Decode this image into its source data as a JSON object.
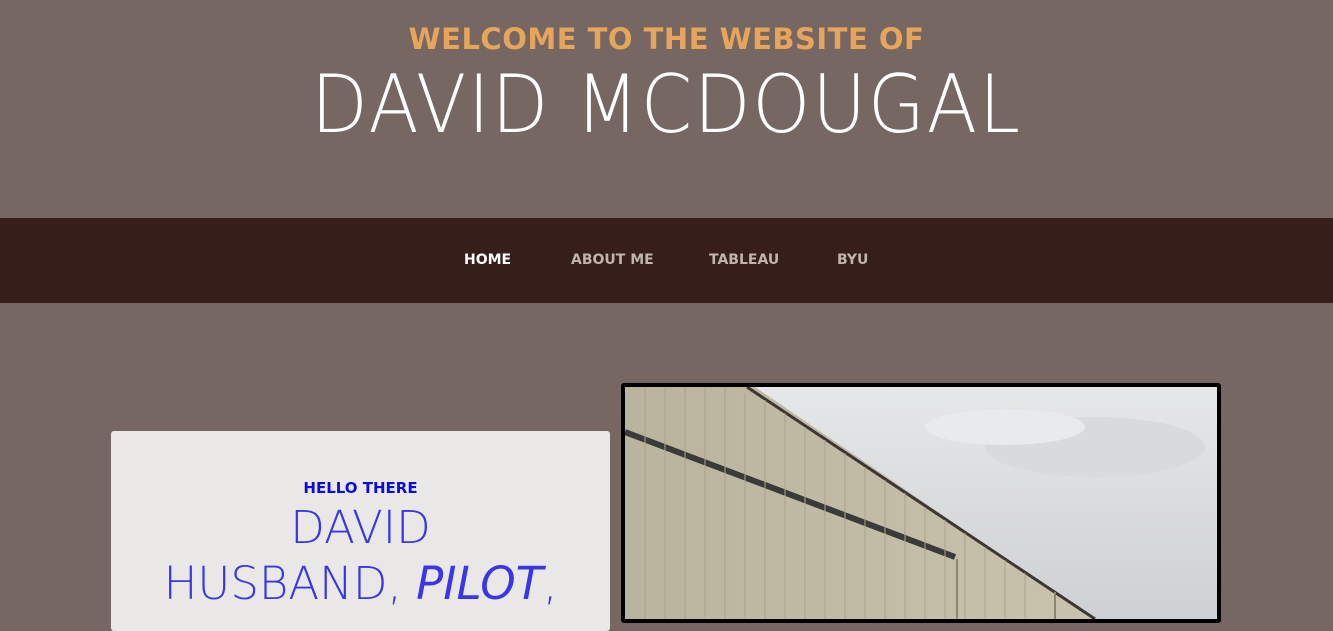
{
  "header": {
    "welcome": "WELCOME TO THE WEBSITE OF",
    "name": "DAVID MCDOUGAL"
  },
  "nav": {
    "items": [
      {
        "label": "HOME",
        "active": true
      },
      {
        "label": "ABOUT ME",
        "active": false
      },
      {
        "label": "TABLEAU",
        "active": false
      },
      {
        "label": "BYU",
        "active": false
      }
    ]
  },
  "intro_card": {
    "eyebrow": "HELLO THERE",
    "line1": "DAVID",
    "line2_part1": "HUSBAND, ",
    "line2_italic": "PILOT",
    "line2_part2": ","
  },
  "colors": {
    "background": "#766762",
    "navbar": "#361e1a",
    "welcome_accent": "#e6a55a",
    "card_text": "#3b35e6",
    "card_background": "#e9e8e7"
  },
  "photo": {
    "icon": "hangar-photo"
  }
}
